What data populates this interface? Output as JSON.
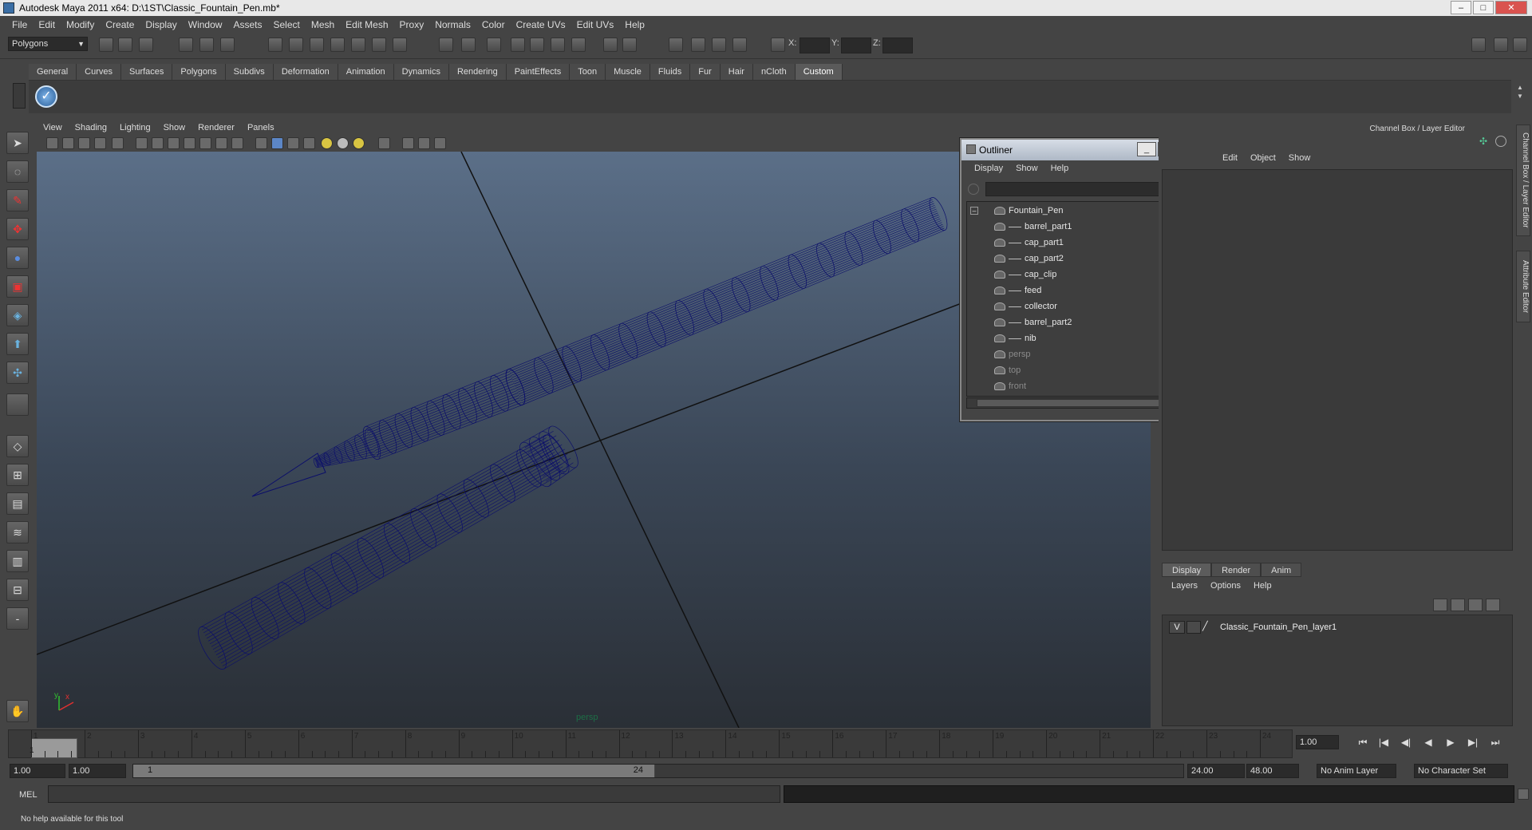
{
  "window": {
    "title": "Autodesk Maya 2011 x64: D:\\1ST\\Classic_Fountain_Pen.mb*",
    "minimize": "–",
    "maximize": "□",
    "close": "✕"
  },
  "menubar": [
    "File",
    "Edit",
    "Modify",
    "Create",
    "Display",
    "Window",
    "Assets",
    "Select",
    "Mesh",
    "Edit Mesh",
    "Proxy",
    "Normals",
    "Color",
    "Create UVs",
    "Edit UVs",
    "Help"
  ],
  "statusline": {
    "mode": "Polygons",
    "x_label": "X:",
    "y_label": "Y:",
    "z_label": "Z:"
  },
  "shelf_tabs": [
    "General",
    "Curves",
    "Surfaces",
    "Polygons",
    "Subdivs",
    "Deformation",
    "Animation",
    "Dynamics",
    "Rendering",
    "PaintEffects",
    "Toon",
    "Muscle",
    "Fluids",
    "Fur",
    "Hair",
    "nCloth",
    "Custom"
  ],
  "shelf_active": "Custom",
  "viewport": {
    "menu": [
      "View",
      "Shading",
      "Lighting",
      "Show",
      "Renderer",
      "Panels"
    ],
    "camera_label": "persp",
    "axis_x": "x",
    "axis_y": "y",
    "wire_color": "#0b0e6a"
  },
  "outliner": {
    "title": "Outliner",
    "menu": [
      "Display",
      "Show",
      "Help"
    ],
    "items": [
      {
        "label": "Fountain_Pen",
        "indent": 0,
        "dim": false
      },
      {
        "label": "barrel_part1",
        "indent": 1,
        "dim": false
      },
      {
        "label": "cap_part1",
        "indent": 1,
        "dim": false
      },
      {
        "label": "cap_part2",
        "indent": 1,
        "dim": false
      },
      {
        "label": "cap_clip",
        "indent": 1,
        "dim": false
      },
      {
        "label": "feed",
        "indent": 1,
        "dim": false
      },
      {
        "label": "collector",
        "indent": 1,
        "dim": false
      },
      {
        "label": "barrel_part2",
        "indent": 1,
        "dim": false
      },
      {
        "label": "nib",
        "indent": 1,
        "dim": false
      },
      {
        "label": "persp",
        "indent": 0,
        "dim": true
      },
      {
        "label": "top",
        "indent": 0,
        "dim": true
      },
      {
        "label": "front",
        "indent": 0,
        "dim": true
      }
    ],
    "expand_toggle": "–"
  },
  "channel_box": {
    "title": "Channel Box / Layer Editor",
    "menu": [
      "Edit",
      "Object",
      "Show"
    ]
  },
  "layer_editor": {
    "tabs": [
      "Display",
      "Render",
      "Anim"
    ],
    "active_tab": "Display",
    "menu": [
      "Layers",
      "Options",
      "Help"
    ],
    "layer": {
      "visible": "V",
      "name": "Classic_Fountain_Pen_layer1"
    }
  },
  "side_tabs": [
    "Channel Box / Layer Editor",
    "Attribute Editor"
  ],
  "timeline": {
    "ticks": [
      "1",
      "2",
      "3",
      "4",
      "5",
      "6",
      "7",
      "8",
      "9",
      "10",
      "11",
      "12",
      "13",
      "14",
      "15",
      "16",
      "17",
      "18",
      "19",
      "20",
      "21",
      "22",
      "23",
      "24"
    ],
    "current_frame": "1",
    "current_time_field": "1.00",
    "playback": [
      "⏮",
      "|◀",
      "◀|",
      "◀",
      "▶",
      "▶|",
      "⏭"
    ]
  },
  "range": {
    "start": "1.00",
    "playback_start": "1.00",
    "range_start_label": "1",
    "range_end_label": "24",
    "playback_end": "24.00",
    "end": "48.00",
    "anim_layer": "No Anim Layer",
    "character_set": "No Character Set"
  },
  "command": {
    "label": "MEL"
  },
  "help_line": "No help available for this tool"
}
